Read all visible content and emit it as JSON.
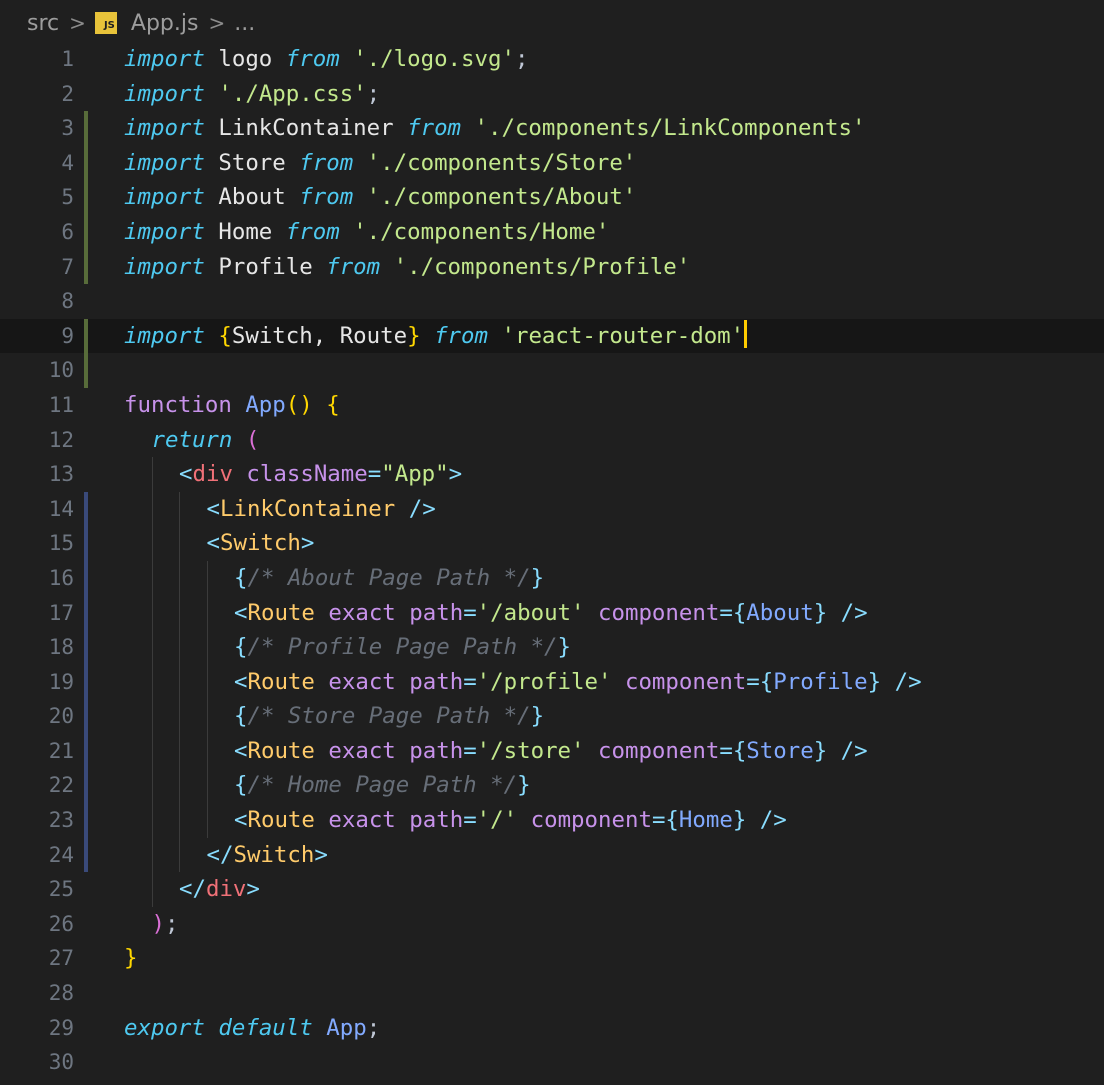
{
  "breadcrumb": {
    "folder": "src",
    "file_badge": "JS",
    "file": "App.js",
    "more": "...",
    "separator": ">"
  },
  "cursor_line": 9,
  "lines": [
    {
      "n": "1",
      "indent": 0,
      "marker": "",
      "tokens": [
        [
          "kw",
          "import"
        ],
        [
          "id",
          " logo "
        ],
        [
          "kw",
          "from"
        ],
        [
          "id",
          " "
        ],
        [
          "str",
          "'./logo.svg'"
        ],
        [
          "punc",
          ";"
        ]
      ]
    },
    {
      "n": "2",
      "indent": 0,
      "marker": "",
      "tokens": [
        [
          "kw",
          "import"
        ],
        [
          "id",
          " "
        ],
        [
          "str",
          "'./App.css'"
        ],
        [
          "punc",
          ";"
        ]
      ]
    },
    {
      "n": "3",
      "indent": 0,
      "marker": "added",
      "tokens": [
        [
          "kw",
          "import"
        ],
        [
          "id",
          " LinkContainer "
        ],
        [
          "kw",
          "from"
        ],
        [
          "id",
          " "
        ],
        [
          "str",
          "'./components/LinkComponents'"
        ]
      ]
    },
    {
      "n": "4",
      "indent": 0,
      "marker": "added",
      "tokens": [
        [
          "kw",
          "import"
        ],
        [
          "id",
          " Store "
        ],
        [
          "kw",
          "from"
        ],
        [
          "id",
          " "
        ],
        [
          "str",
          "'./components/Store'"
        ]
      ]
    },
    {
      "n": "5",
      "indent": 0,
      "marker": "added",
      "tokens": [
        [
          "kw",
          "import"
        ],
        [
          "id",
          " About "
        ],
        [
          "kw",
          "from"
        ],
        [
          "id",
          " "
        ],
        [
          "str",
          "'./components/About'"
        ]
      ]
    },
    {
      "n": "6",
      "indent": 0,
      "marker": "added",
      "tokens": [
        [
          "kw",
          "import"
        ],
        [
          "id",
          " Home "
        ],
        [
          "kw",
          "from"
        ],
        [
          "id",
          " "
        ],
        [
          "str",
          "'./components/Home'"
        ]
      ]
    },
    {
      "n": "7",
      "indent": 0,
      "marker": "added",
      "tokens": [
        [
          "kw",
          "import"
        ],
        [
          "id",
          " Profile "
        ],
        [
          "kw",
          "from"
        ],
        [
          "id",
          " "
        ],
        [
          "str",
          "'./components/Profile'"
        ]
      ]
    },
    {
      "n": "8",
      "indent": 0,
      "marker": "",
      "tokens": []
    },
    {
      "n": "9",
      "indent": 0,
      "marker": "added",
      "tokens": [
        [
          "kw",
          "import"
        ],
        [
          "id",
          " "
        ],
        [
          "brace",
          "{"
        ],
        [
          "id",
          "Switch, Route"
        ],
        [
          "brace",
          "}"
        ],
        [
          "id",
          " "
        ],
        [
          "kw",
          "from"
        ],
        [
          "id",
          " "
        ],
        [
          "str",
          "'react-router-dom'"
        ]
      ]
    },
    {
      "n": "10",
      "indent": 0,
      "marker": "added",
      "tokens": []
    },
    {
      "n": "11",
      "indent": 0,
      "marker": "",
      "tokens": [
        [
          "fnkw",
          "function"
        ],
        [
          "id",
          " "
        ],
        [
          "fn",
          "App"
        ],
        [
          "brace",
          "()"
        ],
        [
          "id",
          " "
        ],
        [
          "brace",
          "{"
        ]
      ]
    },
    {
      "n": "12",
      "indent": 1,
      "marker": "",
      "tokens": [
        [
          "kw",
          "return"
        ],
        [
          "id",
          " "
        ],
        [
          "paren",
          "("
        ]
      ]
    },
    {
      "n": "13",
      "indent": 2,
      "marker": "",
      "tokens": [
        [
          "tagpunc",
          "<"
        ],
        [
          "tag",
          "div"
        ],
        [
          "id",
          " "
        ],
        [
          "attr",
          "className"
        ],
        [
          "tagpunc",
          "="
        ],
        [
          "str",
          "\"App\""
        ],
        [
          "tagpunc",
          ">"
        ]
      ]
    },
    {
      "n": "14",
      "indent": 3,
      "marker": "modified",
      "tokens": [
        [
          "tagpunc",
          "<"
        ],
        [
          "comp",
          "LinkContainer"
        ],
        [
          "id",
          " "
        ],
        [
          "tagpunc",
          "/>"
        ]
      ]
    },
    {
      "n": "15",
      "indent": 3,
      "marker": "modified",
      "tokens": [
        [
          "tagpunc",
          "<"
        ],
        [
          "comp",
          "Switch"
        ],
        [
          "tagpunc",
          ">"
        ]
      ]
    },
    {
      "n": "16",
      "indent": 4,
      "marker": "modified",
      "tokens": [
        [
          "brace2",
          "{"
        ],
        [
          "comment",
          "/* About Page Path */"
        ],
        [
          "brace2",
          "}"
        ]
      ]
    },
    {
      "n": "17",
      "indent": 4,
      "marker": "modified",
      "tokens": [
        [
          "tagpunc",
          "<"
        ],
        [
          "comp",
          "Route"
        ],
        [
          "id",
          " "
        ],
        [
          "attr",
          "exact"
        ],
        [
          "id",
          " "
        ],
        [
          "attr",
          "path"
        ],
        [
          "tagpunc",
          "="
        ],
        [
          "str",
          "'/about'"
        ],
        [
          "id",
          " "
        ],
        [
          "attr",
          "component"
        ],
        [
          "tagpunc",
          "="
        ],
        [
          "brace2",
          "{"
        ],
        [
          "val",
          "About"
        ],
        [
          "brace2",
          "}"
        ],
        [
          "id",
          " "
        ],
        [
          "tagpunc",
          "/>"
        ]
      ]
    },
    {
      "n": "18",
      "indent": 4,
      "marker": "modified",
      "tokens": [
        [
          "brace2",
          "{"
        ],
        [
          "comment",
          "/* Profile Page Path */"
        ],
        [
          "brace2",
          "}"
        ]
      ]
    },
    {
      "n": "19",
      "indent": 4,
      "marker": "modified",
      "tokens": [
        [
          "tagpunc",
          "<"
        ],
        [
          "comp",
          "Route"
        ],
        [
          "id",
          " "
        ],
        [
          "attr",
          "exact"
        ],
        [
          "id",
          " "
        ],
        [
          "attr",
          "path"
        ],
        [
          "tagpunc",
          "="
        ],
        [
          "str",
          "'/profile'"
        ],
        [
          "id",
          " "
        ],
        [
          "attr",
          "component"
        ],
        [
          "tagpunc",
          "="
        ],
        [
          "brace2",
          "{"
        ],
        [
          "val",
          "Profile"
        ],
        [
          "brace2",
          "}"
        ],
        [
          "id",
          " "
        ],
        [
          "tagpunc",
          "/>"
        ]
      ]
    },
    {
      "n": "20",
      "indent": 4,
      "marker": "modified",
      "tokens": [
        [
          "brace2",
          "{"
        ],
        [
          "comment",
          "/* Store Page Path */"
        ],
        [
          "brace2",
          "}"
        ]
      ]
    },
    {
      "n": "21",
      "indent": 4,
      "marker": "modified",
      "tokens": [
        [
          "tagpunc",
          "<"
        ],
        [
          "comp",
          "Route"
        ],
        [
          "id",
          " "
        ],
        [
          "attr",
          "exact"
        ],
        [
          "id",
          " "
        ],
        [
          "attr",
          "path"
        ],
        [
          "tagpunc",
          "="
        ],
        [
          "str",
          "'/store'"
        ],
        [
          "id",
          " "
        ],
        [
          "attr",
          "component"
        ],
        [
          "tagpunc",
          "="
        ],
        [
          "brace2",
          "{"
        ],
        [
          "val",
          "Store"
        ],
        [
          "brace2",
          "}"
        ],
        [
          "id",
          " "
        ],
        [
          "tagpunc",
          "/>"
        ]
      ]
    },
    {
      "n": "22",
      "indent": 4,
      "marker": "modified",
      "tokens": [
        [
          "brace2",
          "{"
        ],
        [
          "comment",
          "/* Home Page Path */"
        ],
        [
          "brace2",
          "}"
        ]
      ]
    },
    {
      "n": "23",
      "indent": 4,
      "marker": "modified",
      "tokens": [
        [
          "tagpunc",
          "<"
        ],
        [
          "comp",
          "Route"
        ],
        [
          "id",
          " "
        ],
        [
          "attr",
          "exact"
        ],
        [
          "id",
          " "
        ],
        [
          "attr",
          "path"
        ],
        [
          "tagpunc",
          "="
        ],
        [
          "str",
          "'/'"
        ],
        [
          "id",
          " "
        ],
        [
          "attr",
          "component"
        ],
        [
          "tagpunc",
          "="
        ],
        [
          "brace2",
          "{"
        ],
        [
          "val",
          "Home"
        ],
        [
          "brace2",
          "}"
        ],
        [
          "id",
          " "
        ],
        [
          "tagpunc",
          "/>"
        ]
      ]
    },
    {
      "n": "24",
      "indent": 3,
      "marker": "modified",
      "tokens": [
        [
          "tagpunc",
          "</"
        ],
        [
          "comp",
          "Switch"
        ],
        [
          "tagpunc",
          ">"
        ]
      ]
    },
    {
      "n": "25",
      "indent": 2,
      "marker": "",
      "tokens": [
        [
          "tagpunc",
          "</"
        ],
        [
          "tag",
          "div"
        ],
        [
          "tagpunc",
          ">"
        ]
      ]
    },
    {
      "n": "26",
      "indent": 1,
      "marker": "",
      "tokens": [
        [
          "paren",
          ")"
        ],
        [
          "punc",
          ";"
        ]
      ]
    },
    {
      "n": "27",
      "indent": 0,
      "marker": "",
      "tokens": [
        [
          "brace",
          "}"
        ]
      ]
    },
    {
      "n": "28",
      "indent": 0,
      "marker": "",
      "tokens": []
    },
    {
      "n": "29",
      "indent": 0,
      "marker": "",
      "tokens": [
        [
          "kw",
          "export"
        ],
        [
          "id",
          " "
        ],
        [
          "kw",
          "default"
        ],
        [
          "id",
          " "
        ],
        [
          "fn",
          "App"
        ],
        [
          "punc",
          ";"
        ]
      ]
    },
    {
      "n": "30",
      "indent": 0,
      "marker": "",
      "tokens": []
    }
  ]
}
